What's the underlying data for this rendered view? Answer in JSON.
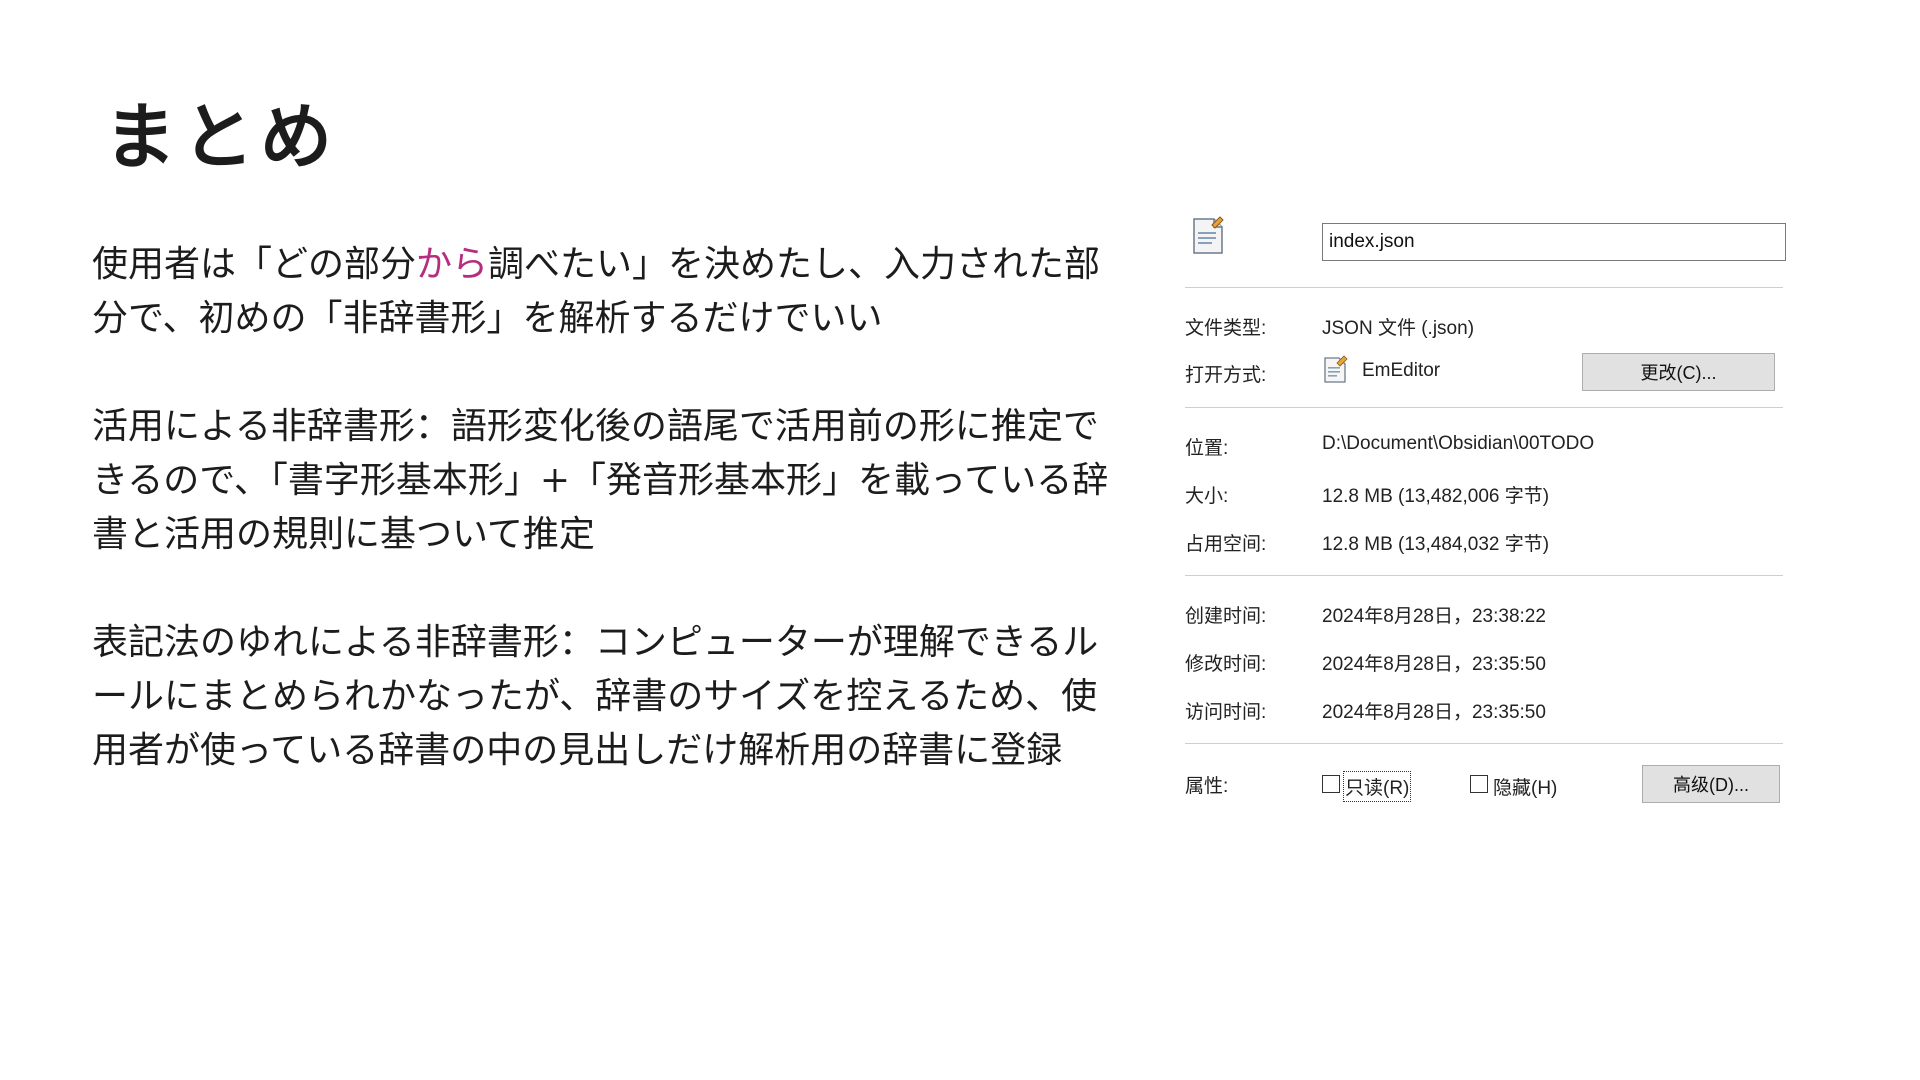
{
  "slide": {
    "title": "まとめ",
    "para1": {
      "before": "使用者は「どの部分",
      "highlight": "から",
      "after": "調べたい」を決めたし、入力された部分で、初めの「非辞書形」を解析するだけでいい"
    },
    "para2": "活用による非辞書形：語形変化後の語尾で活用前の形に推定できるので、「書字形基本形」+「発音形基本形」を載っている辞書と活用の規則に基ついて推定",
    "para3": "表記法のゆれによる非辞書形：コンピューターが理解できるルールにまとめられかなったが、辞書のサイズを控えるため、使用者が使っている辞書の中の見出しだけ解析用の辞書に登録",
    "highlight_color": "#b52d7f"
  },
  "properties": {
    "file_name": "index.json",
    "file_type_label": "文件类型:",
    "file_type_value": "JSON 文件 (.json)",
    "open_with_label": "打开方式:",
    "open_with_value": "EmEditor",
    "change_button": "更改(C)...",
    "location_label": "位置:",
    "location_value": "D:\\Document\\Obsidian\\00TODO",
    "size_label": "大小:",
    "size_value": "12.8 MB (13,482,006 字节)",
    "size_on_disk_label": "占用空间:",
    "size_on_disk_value": "12.8 MB (13,484,032 字节)",
    "created_label": "创建时间:",
    "created_value": "2024年8月28日，23:38:22",
    "modified_label": "修改时间:",
    "modified_value": "2024年8月28日，23:35:50",
    "accessed_label": "访问时间:",
    "accessed_value": "2024年8月28日，23:35:50",
    "attributes_label": "属性:",
    "readonly_label": "只读(R)",
    "hidden_label": "隐藏(H)",
    "advanced_button": "高级(D)..."
  }
}
